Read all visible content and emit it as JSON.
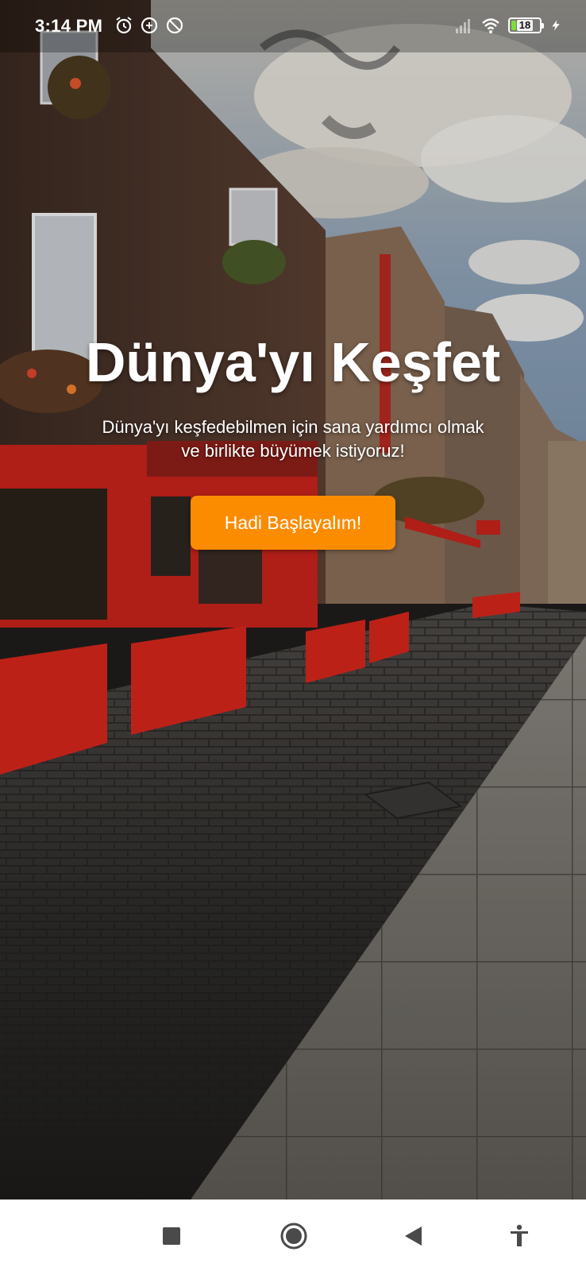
{
  "status_bar": {
    "time": "3:14 PM",
    "left_icons": [
      "alarm-icon",
      "data-saver-icon",
      "do-not-disturb-icon"
    ],
    "right_icons": [
      "signal-icon",
      "wifi-icon",
      "battery-icon",
      "charging-icon"
    ],
    "battery_level": "18"
  },
  "hero": {
    "title": "Dünya'yı Keşfet",
    "subtitle_line1": "Dünya'yı keşfedebilmen için sana yardımcı olmak",
    "subtitle_line2": "ve birlikte büyümek istiyoruz!",
    "cta_label": "Hadi Başlayalım!"
  },
  "colors": {
    "cta": "#fb8c00",
    "storefront_red": "#d9261c",
    "nav_background": "#ffffff"
  },
  "navigation_bar": {
    "buttons": [
      "recents-square-icon",
      "home-circle-icon",
      "back-triangle-icon",
      "accessibility-icon"
    ]
  }
}
